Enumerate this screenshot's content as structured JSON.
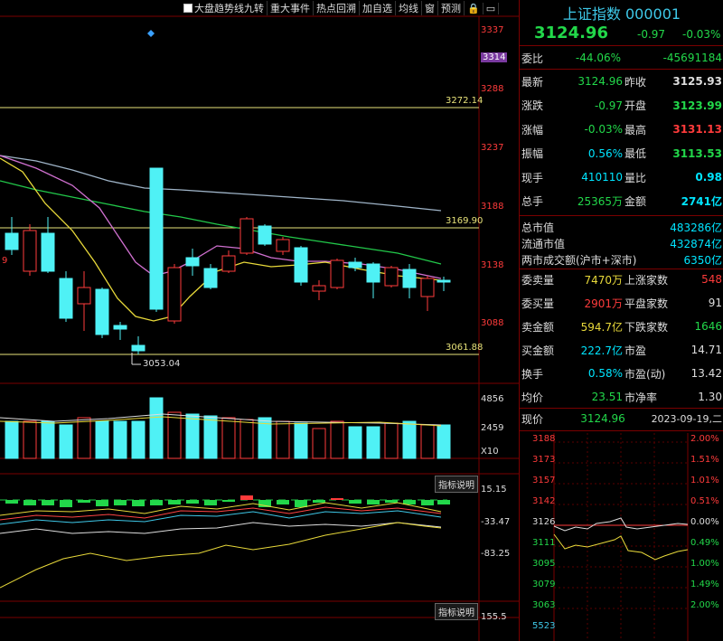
{
  "toolbar": {
    "items": [
      "大盘趋势线九转",
      "重大事件",
      "热点回溯",
      "加自选",
      "均线",
      "窗",
      "预测"
    ]
  },
  "kline": {
    "price_labels": [
      "3337",
      "3314",
      "3288",
      "3237",
      "3188",
      "3138",
      "3088"
    ],
    "high_line_label": "3272.14",
    "mid_line_label": "3169.90",
    "low_line_label": "3061.88",
    "low_marker": "3053.04",
    "left_marker": "9"
  },
  "volume": {
    "labels": [
      "4856",
      "2459",
      "X10"
    ]
  },
  "indicator1": {
    "button": "指标说明",
    "labels": [
      "15.15",
      "-33.47",
      "-83.25"
    ]
  },
  "indicator2": {
    "button": "指标说明",
    "labels": [
      "155.5"
    ]
  },
  "quote": {
    "title": "上证指数 000001",
    "price": "3124.96",
    "change": "-0.97",
    "change_pct": "-0.03%",
    "weibi_label": "委比",
    "weibi_pct": "-44.06%",
    "weibi_val": "-45691184",
    "rows": [
      {
        "l1": "最新",
        "v1": "3124.96",
        "l2": "昨收",
        "v2": "3125.93"
      },
      {
        "l1": "涨跌",
        "v1": "-0.97",
        "l2": "开盘",
        "v2": "3123.99"
      },
      {
        "l1": "涨幅",
        "v1": "-0.03%",
        "l2": "最高",
        "v2": "3131.13"
      },
      {
        "l1": "振幅",
        "v1": "0.56%",
        "l2": "最低",
        "v2": "3113.53"
      },
      {
        "l1": "现手",
        "v1": "410110",
        "l2": "量比",
        "v2": "0.98"
      },
      {
        "l1": "总手",
        "v1": "25365万",
        "l2": "金额",
        "v2": "2741亿"
      }
    ],
    "cap_rows": [
      {
        "l": "总市值",
        "v": "483286亿"
      },
      {
        "l": "流通市值",
        "v": "432874亿"
      },
      {
        "l": "两市成交额(沪市+深市)",
        "v": "6350亿"
      }
    ],
    "stat_rows": [
      {
        "l1": "委卖量",
        "v1": "7470万",
        "l2": "上涨家数",
        "v2": "548"
      },
      {
        "l1": "委买量",
        "v1": "2901万",
        "l2": "平盘家数",
        "v2": "91"
      },
      {
        "l1": "卖金额",
        "v1": "594.7亿",
        "l2": "下跌家数",
        "v2": "1646"
      },
      {
        "l1": "买金额",
        "v1": "222.7亿",
        "l2": "市盈",
        "v2": "14.71"
      },
      {
        "l1": "换手",
        "v1": "0.58%",
        "l2": "市盈(动)",
        "v2": "13.42"
      },
      {
        "l1": "均价",
        "v1": "23.51",
        "l2": "市净率",
        "v2": "1.30"
      }
    ],
    "now_label": "现价",
    "now_price": "3124.96",
    "date": "2023-09-19,二"
  },
  "mini": {
    "left": [
      "3188",
      "3173",
      "3157",
      "3142",
      "3126",
      "3111",
      "3095",
      "3079",
      "3063",
      "5523"
    ],
    "right": [
      "2.00%",
      "1.51%",
      "1.01%",
      "0.51%",
      "0.00%",
      "0.49%",
      "1.00%",
      "1.49%",
      "2.00%"
    ]
  },
  "colors": {
    "up": "#ff3b3b",
    "down": "#4ff1f5",
    "bg": "#000000",
    "grid": "#7a0000"
  }
}
